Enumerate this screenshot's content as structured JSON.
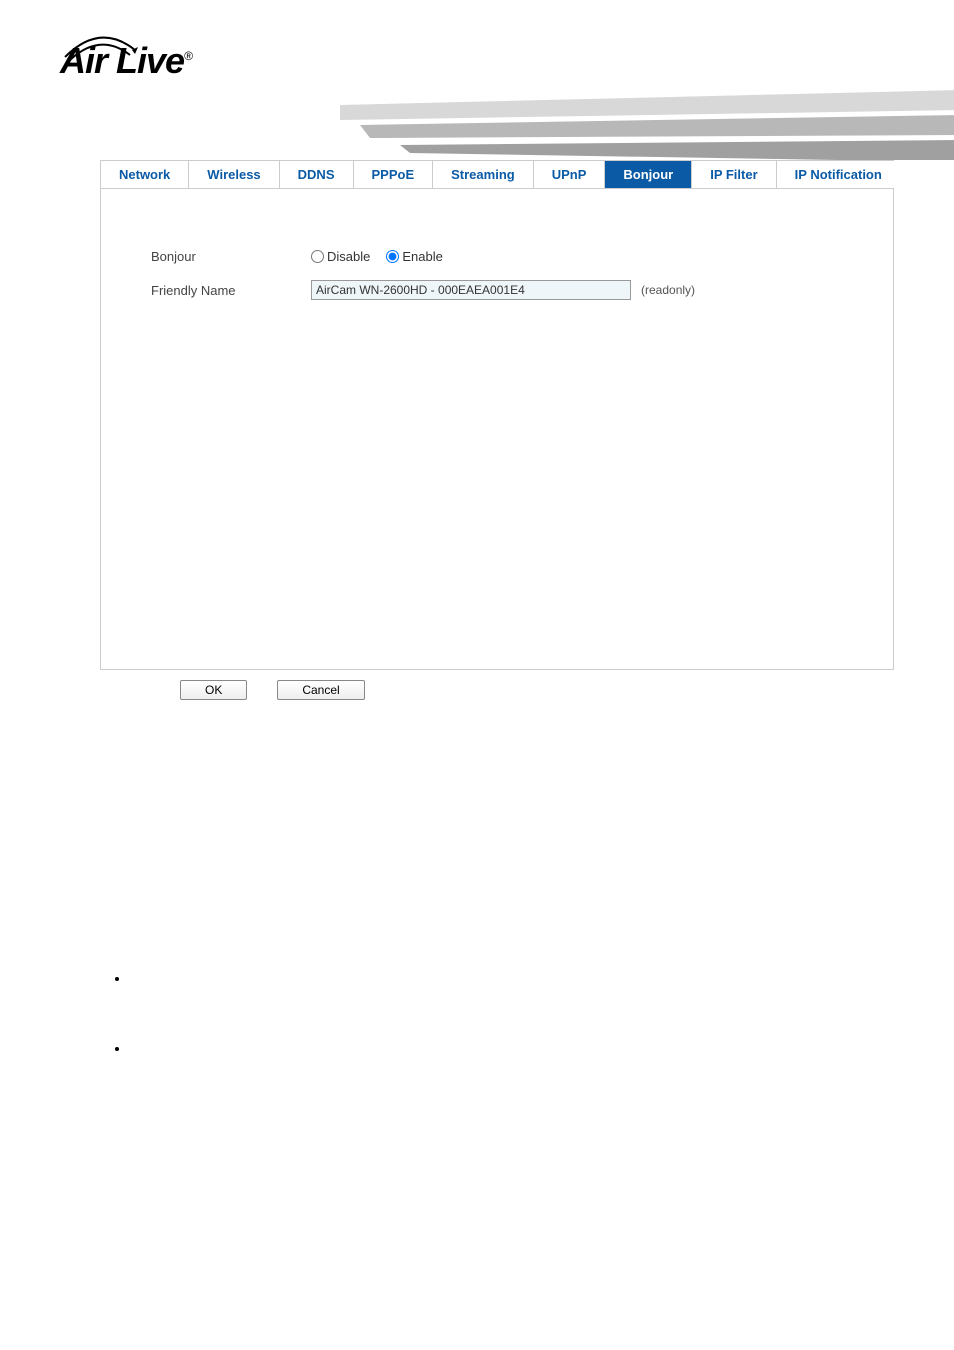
{
  "logo": {
    "text": "Air Live",
    "registered": "®"
  },
  "tabs": [
    {
      "label": "Network"
    },
    {
      "label": "Wireless"
    },
    {
      "label": "DDNS"
    },
    {
      "label": "PPPoE"
    },
    {
      "label": "Streaming"
    },
    {
      "label": "UPnP"
    },
    {
      "label": "Bonjour",
      "active": true
    },
    {
      "label": "IP Filter"
    },
    {
      "label": "IP Notification"
    }
  ],
  "form": {
    "bonjour_label": "Bonjour",
    "disable_label": "Disable",
    "enable_label": "Enable",
    "friendly_name_label": "Friendly Name",
    "friendly_name_value": "AirCam WN-2600HD - 000EAEA001E4",
    "readonly_hint": "(readonly)"
  },
  "buttons": {
    "ok": "OK",
    "cancel": "Cancel"
  }
}
